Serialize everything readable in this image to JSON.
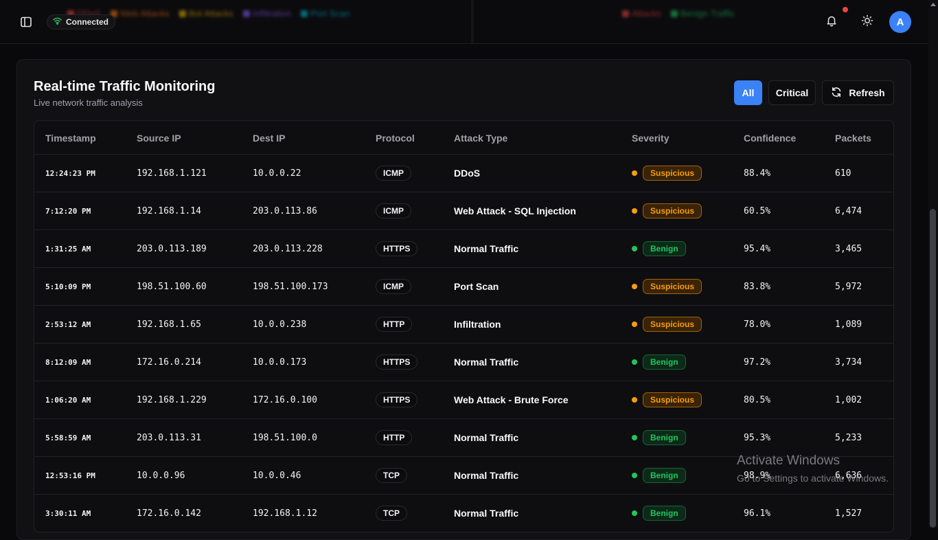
{
  "header": {
    "connection_status": "Connected",
    "avatar_initial": "A",
    "blurred_legend_left": [
      {
        "label": "DDoS",
        "color": "#ef4444"
      },
      {
        "label": "Web Attacks",
        "color": "#f97316"
      },
      {
        "label": "Bot Attacks",
        "color": "#eab308"
      },
      {
        "label": "Infiltration",
        "color": "#8b5cf6"
      },
      {
        "label": "Port Scan",
        "color": "#06b6d4"
      }
    ],
    "blurred_legend_right": [
      {
        "label": "Attacks",
        "color": "#ef4444"
      },
      {
        "label": "Benign Traffic",
        "color": "#22c55e"
      }
    ]
  },
  "panel": {
    "title": "Real-time Traffic Monitoring",
    "subtitle": "Live network traffic analysis",
    "filter_all": "All",
    "filter_critical": "Critical",
    "refresh": "Refresh"
  },
  "table": {
    "columns": [
      "Timestamp",
      "Source IP",
      "Dest IP",
      "Protocol",
      "Attack Type",
      "Severity",
      "Confidence",
      "Packets"
    ],
    "rows": [
      {
        "timestamp": "12:24:23 PM",
        "source_ip": "192.168.1.121",
        "dest_ip": "10.0.0.22",
        "protocol": "ICMP",
        "attack_type": "DDoS",
        "severity": "Suspicious",
        "confidence": "88.4%",
        "packets": "610"
      },
      {
        "timestamp": "7:12:20 PM",
        "source_ip": "192.168.1.14",
        "dest_ip": "203.0.113.86",
        "protocol": "ICMP",
        "attack_type": "Web Attack - SQL Injection",
        "severity": "Suspicious",
        "confidence": "60.5%",
        "packets": "6,474"
      },
      {
        "timestamp": "1:31:25 AM",
        "source_ip": "203.0.113.189",
        "dest_ip": "203.0.113.228",
        "protocol": "HTTPS",
        "attack_type": "Normal Traffic",
        "severity": "Benign",
        "confidence": "95.4%",
        "packets": "3,465"
      },
      {
        "timestamp": "5:10:09 PM",
        "source_ip": "198.51.100.60",
        "dest_ip": "198.51.100.173",
        "protocol": "ICMP",
        "attack_type": "Port Scan",
        "severity": "Suspicious",
        "confidence": "83.8%",
        "packets": "5,972"
      },
      {
        "timestamp": "2:53:12 AM",
        "source_ip": "192.168.1.65",
        "dest_ip": "10.0.0.238",
        "protocol": "HTTP",
        "attack_type": "Infiltration",
        "severity": "Suspicious",
        "confidence": "78.0%",
        "packets": "1,089"
      },
      {
        "timestamp": "8:12:09 AM",
        "source_ip": "172.16.0.214",
        "dest_ip": "10.0.0.173",
        "protocol": "HTTPS",
        "attack_type": "Normal Traffic",
        "severity": "Benign",
        "confidence": "97.2%",
        "packets": "3,734"
      },
      {
        "timestamp": "1:06:20 AM",
        "source_ip": "192.168.1.229",
        "dest_ip": "172.16.0.100",
        "protocol": "HTTPS",
        "attack_type": "Web Attack - Brute Force",
        "severity": "Suspicious",
        "confidence": "80.5%",
        "packets": "1,002"
      },
      {
        "timestamp": "5:58:59 AM",
        "source_ip": "203.0.113.31",
        "dest_ip": "198.51.100.0",
        "protocol": "HTTP",
        "attack_type": "Normal Traffic",
        "severity": "Benign",
        "confidence": "95.3%",
        "packets": "5,233"
      },
      {
        "timestamp": "12:53:16 PM",
        "source_ip": "10.0.0.96",
        "dest_ip": "10.0.0.46",
        "protocol": "TCP",
        "attack_type": "Normal Traffic",
        "severity": "Benign",
        "confidence": "98.9%",
        "packets": "6,636"
      },
      {
        "timestamp": "3:30:11 AM",
        "source_ip": "172.16.0.142",
        "dest_ip": "192.168.1.12",
        "protocol": "TCP",
        "attack_type": "Normal Traffic",
        "severity": "Benign",
        "confidence": "96.1%",
        "packets": "1,527"
      }
    ]
  },
  "severity_colors": {
    "Suspicious": "#f59e0b",
    "Benign": "#22c55e"
  },
  "watermark": {
    "line1": "Activate Windows",
    "line2": "Go to Settings to activate Windows."
  }
}
